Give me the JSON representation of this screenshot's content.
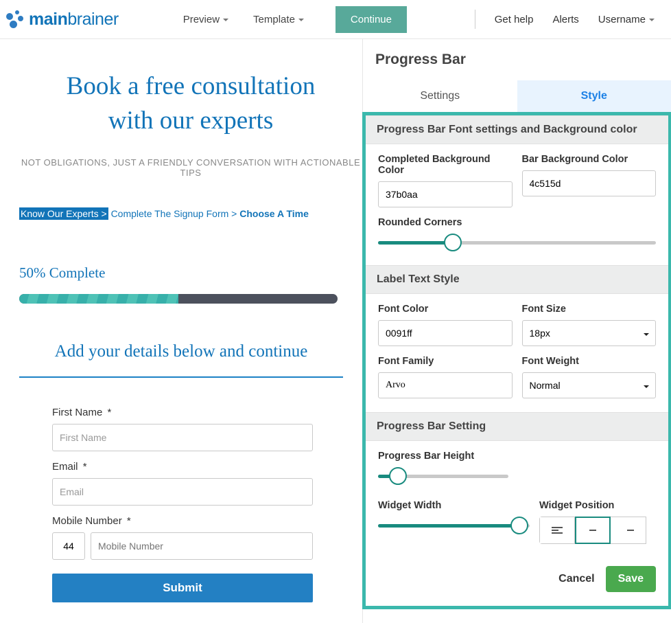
{
  "logo": {
    "main": "main",
    "brainer": "brainer"
  },
  "nav": {
    "preview": "Preview",
    "template": "Template",
    "continue": "Continue",
    "get_help": "Get help",
    "alerts": "Alerts",
    "username": "Username"
  },
  "hero": {
    "title_line1": "Book a free consultation",
    "title_line2": "with our experts",
    "sub": "NOT OBLIGATIONS, JUST A FRIENDLY CONVERSATION WITH ACTIONABLE TIPS"
  },
  "crumbs": {
    "step1": "Know Our Experts >",
    "step2": "Complete The Signup Form",
    "sep": ">",
    "step3": "Choose A Time"
  },
  "progress": {
    "label": "50% Complete",
    "percent": 50
  },
  "form": {
    "heading": "Add your details below and continue",
    "first_name_label": "First Name",
    "first_name_ph": "First Name",
    "email_label": "Email",
    "email_ph": "Email",
    "mobile_label": "Mobile Number",
    "cc_value": "44",
    "mobile_ph": "Mobile Number",
    "asterisk": "*",
    "submit": "Submit"
  },
  "panel": {
    "title": "Progress Bar",
    "tabs": {
      "settings": "Settings",
      "style": "Style"
    },
    "sections": {
      "font_bg": "Progress Bar Font settings and Background color",
      "label_text": "Label Text Style",
      "bar_setting": "Progress Bar Setting"
    },
    "fields": {
      "completed_bg": {
        "label": "Completed Background Color",
        "value": "37b0aa"
      },
      "bar_bg": {
        "label": "Bar Background Color",
        "value": "4c515d"
      },
      "rounded": {
        "label": "Rounded Corners",
        "percent": 27
      },
      "font_color": {
        "label": "Font Color",
        "value": "0091ff"
      },
      "font_size": {
        "label": "Font Size",
        "value": "18px"
      },
      "font_family": {
        "label": "Font Family",
        "value": "Arvo"
      },
      "font_weight": {
        "label": "Font Weight",
        "value": "Normal"
      },
      "bar_height": {
        "label": "Progress Bar Height",
        "percent": 10
      },
      "widget_width": {
        "label": "Widget Width",
        "percent": 93
      },
      "widget_pos": {
        "label": "Widget Position"
      }
    },
    "actions": {
      "cancel": "Cancel",
      "save": "Save"
    }
  }
}
